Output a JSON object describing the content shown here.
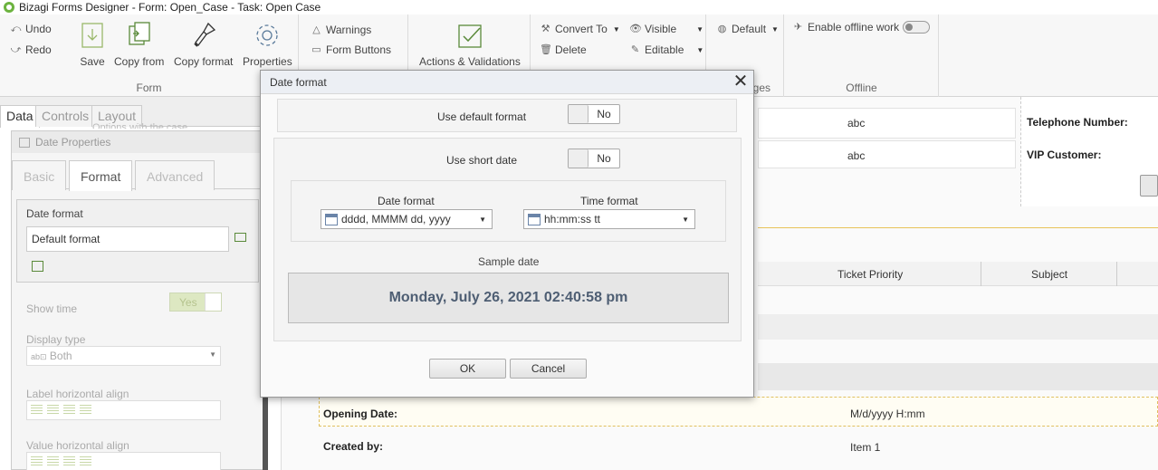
{
  "window": {
    "title": "Bizagi Forms Designer  - Form: Open_Case - Task:  Open Case"
  },
  "ribbon": {
    "undo": "Undo",
    "redo": "Redo",
    "save": "Save",
    "copy_from": "Copy from",
    "copy_format": "Copy format",
    "properties": "Properties",
    "form_group": "Form",
    "warnings": "Warnings",
    "form_buttons": "Form Buttons",
    "actions_validations": "Actions & Validations",
    "convert_to": "Convert To",
    "delete": "Delete",
    "visible": "Visible",
    "editable": "Editable",
    "default_lang": "Default",
    "ges_fragment": "ges",
    "offline_label": "Enable offline work",
    "offline_group": "Offline"
  },
  "left_panel": {
    "tabs": [
      "Data",
      "Controls",
      "Layout"
    ],
    "faded_text": "Options with the case",
    "date_properties_title": "Date Properties",
    "prop_tabs": [
      "Basic",
      "Format",
      "Advanced"
    ],
    "date_format_label": "Date format",
    "date_format_value": "Default format",
    "show_time_label": "Show time",
    "show_time_value": "Yes",
    "display_type_label": "Display type",
    "display_type_value": "Both",
    "label_align_label": "Label horizontal align",
    "value_align_label": "Value horizontal align"
  },
  "background_form": {
    "abc1": "abc",
    "abc2": "abc",
    "telephone": "Telephone Number:",
    "vip": "VIP Customer:",
    "col_ticket_priority": "Ticket Priority",
    "col_subject": "Subject",
    "opening_date_label": "Opening Date:",
    "opening_date_value": "M/d/yyyy H:mm",
    "created_by_label": "Created by:",
    "created_by_value": "Item 1"
  },
  "dialog": {
    "title": "Date format",
    "use_default_label": "Use default format",
    "use_default_value": "No",
    "use_short_label": "Use short date",
    "use_short_value": "No",
    "date_format_label": "Date format",
    "date_format_value": "dddd, MMMM dd, yyyy",
    "time_format_label": "Time format",
    "time_format_value": "hh:mm:ss tt",
    "sample_label": "Sample date",
    "sample_value": "Monday, July 26, 2021 02:40:58 pm",
    "ok": "OK",
    "cancel": "Cancel"
  }
}
